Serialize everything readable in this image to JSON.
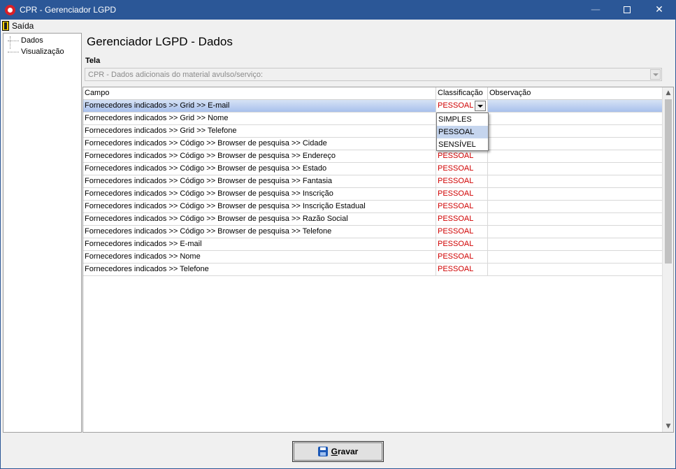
{
  "window": {
    "title": "CPR - Gerenciador LGPD"
  },
  "menu": {
    "exit_label": "Saída"
  },
  "tree": {
    "items": [
      "Dados",
      "Visualização"
    ]
  },
  "main": {
    "title": "Gerenciador LGPD - Dados",
    "screen_label": "Tela",
    "screen_value": "CPR - Dados adicionais do material avulso/serviço:"
  },
  "grid": {
    "headers": {
      "campo": "Campo",
      "classificacao": "Classificação",
      "observacao": "Observação"
    },
    "rows": [
      {
        "campo": "Fornecedores indicados >> Grid >> E-mail",
        "classificacao": "PESSOAL",
        "observacao": ""
      },
      {
        "campo": "Fornecedores indicados >> Grid >> Nome",
        "classificacao": "",
        "observacao": ""
      },
      {
        "campo": "Fornecedores indicados >> Grid >> Telefone",
        "classificacao": "",
        "observacao": ""
      },
      {
        "campo": "Fornecedores indicados >> Código >> Browser de pesquisa >> Cidade",
        "classificacao": "",
        "observacao": ""
      },
      {
        "campo": "Fornecedores indicados >> Código >> Browser de pesquisa >> Endereço",
        "classificacao": "PESSOAL",
        "observacao": ""
      },
      {
        "campo": "Fornecedores indicados >> Código >> Browser de pesquisa >> Estado",
        "classificacao": "PESSOAL",
        "observacao": ""
      },
      {
        "campo": "Fornecedores indicados >> Código >> Browser de pesquisa >> Fantasia",
        "classificacao": "PESSOAL",
        "observacao": ""
      },
      {
        "campo": "Fornecedores indicados >> Código >> Browser de pesquisa >> Inscrição",
        "classificacao": "PESSOAL",
        "observacao": ""
      },
      {
        "campo": "Fornecedores indicados >> Código >> Browser de pesquisa >> Inscrição Estadual",
        "classificacao": "PESSOAL",
        "observacao": ""
      },
      {
        "campo": "Fornecedores indicados >> Código >> Browser de pesquisa >> Razão Social",
        "classificacao": "PESSOAL",
        "observacao": ""
      },
      {
        "campo": "Fornecedores indicados >> Código >> Browser de pesquisa >> Telefone",
        "classificacao": "PESSOAL",
        "observacao": ""
      },
      {
        "campo": "Fornecedores indicados >> E-mail",
        "classificacao": "PESSOAL",
        "observacao": ""
      },
      {
        "campo": "Fornecedores indicados >> Nome",
        "classificacao": "PESSOAL",
        "observacao": ""
      },
      {
        "campo": "Fornecedores indicados >> Telefone",
        "classificacao": "PESSOAL",
        "observacao": ""
      }
    ],
    "dropdown_options": [
      "SIMPLES",
      "PESSOAL",
      "SENSÍVEL"
    ],
    "dropdown_highlighted": "PESSOAL"
  },
  "footer": {
    "save_label": "Gravar",
    "save_mnemonic": "G"
  },
  "colors": {
    "titlebar": "#2b5797",
    "classification_text": "#d00000",
    "selected_row": "#a8c0ec"
  }
}
